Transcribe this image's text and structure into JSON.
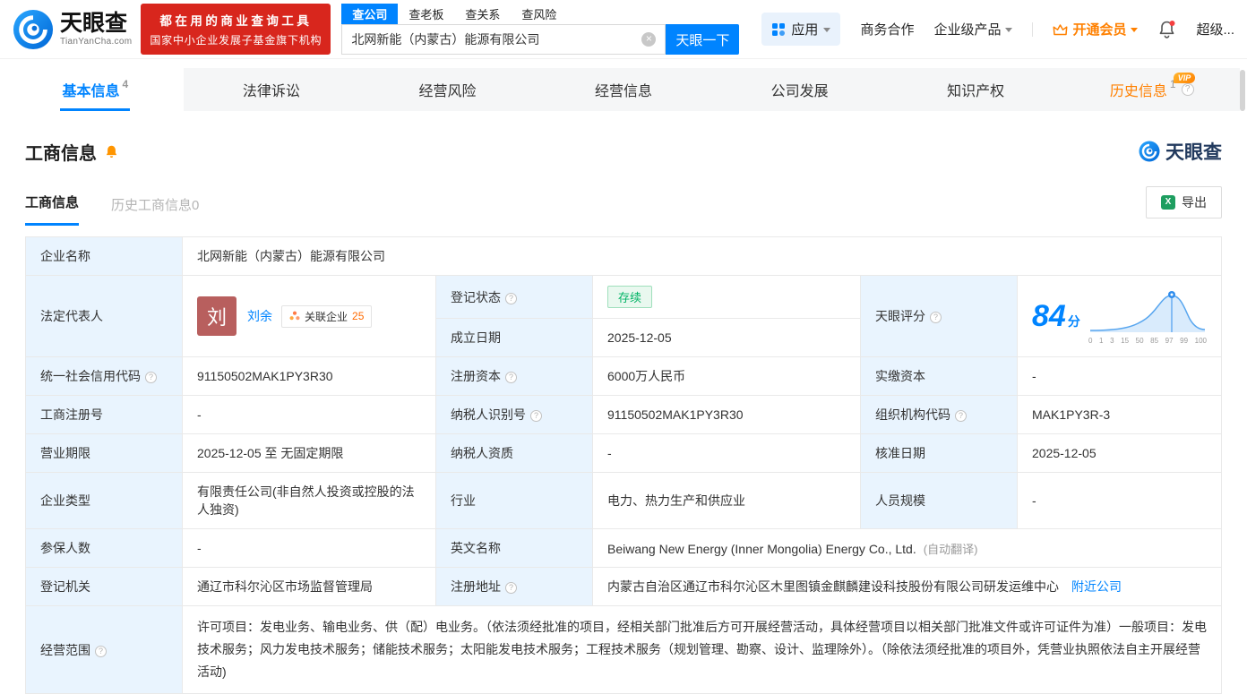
{
  "header": {
    "logo_cn": "天眼查",
    "logo_en": "TianYanCha.com",
    "promo_line1": "都在用的商业查询工具",
    "promo_line2": "国家中小企业发展子基金旗下机构",
    "search_tabs": [
      "查公司",
      "查老板",
      "查关系",
      "查风险"
    ],
    "search_value": "北网新能（内蒙古）能源有限公司",
    "search_button": "天眼一下",
    "apps_label": "应用",
    "nav_cooperation": "商务合作",
    "nav_enterprise": "企业级产品",
    "nav_vip": "开通会员",
    "nav_super": "超级..."
  },
  "tabs": {
    "basic": "基本信息",
    "basic_count": "4",
    "legal": "法律诉讼",
    "risk": "经营风险",
    "operation": "经营信息",
    "development": "公司发展",
    "ip": "知识产权",
    "history": "历史信息",
    "history_count": "1",
    "history_vip": "VIP"
  },
  "section": {
    "title": "工商信息",
    "brand": "天眼查",
    "subtab_active": "工商信息",
    "subtab_history": "历史工商信息0",
    "export_label": "导出"
  },
  "info": {
    "company_name_label": "企业名称",
    "company_name": "北网新能（内蒙古）能源有限公司",
    "legal_rep_label": "法定代表人",
    "legal_rep_avatar": "刘",
    "legal_rep_name": "刘余",
    "related_label": "关联企业",
    "related_count": "25",
    "reg_status_label": "登记状态",
    "reg_status": "存续",
    "establish_label": "成立日期",
    "establish_date": "2025-12-05",
    "score_label": "天眼评分",
    "score_value": "84",
    "score_unit": "分",
    "credit_code_label": "统一社会信用代码",
    "credit_code": "91150502MAK1PY3R30",
    "reg_capital_label": "注册资本",
    "reg_capital": "6000万人民币",
    "paid_capital_label": "实缴资本",
    "paid_capital": "-",
    "reg_no_label": "工商注册号",
    "reg_no": "-",
    "taxpayer_id_label": "纳税人识别号",
    "taxpayer_id": "91150502MAK1PY3R30",
    "org_code_label": "组织机构代码",
    "org_code": "MAK1PY3R-3",
    "term_label": "营业期限",
    "term": "2025-12-05 至 无固定期限",
    "taxpayer_qual_label": "纳税人资质",
    "taxpayer_qual": "-",
    "approval_label": "核准日期",
    "approval_date": "2025-12-05",
    "type_label": "企业类型",
    "type": "有限责任公司(非自然人投资或控股的法人独资)",
    "industry_label": "行业",
    "industry": "电力、热力生产和供应业",
    "staff_label": "人员规模",
    "staff": "-",
    "insured_label": "参保人数",
    "insured": "-",
    "en_name_label": "英文名称",
    "en_name": "Beiwang New Energy (Inner Mongolia) Energy Co., Ltd.",
    "en_name_note": "(自动翻译)",
    "authority_label": "登记机关",
    "authority": "通辽市科尔沁区市场监督管理局",
    "address_label": "注册地址",
    "address": "内蒙古自治区通辽市科尔沁区木里图镇金麒麟建设科技股份有限公司研发运维中心",
    "nearby": "附近公司",
    "scope_label": "经营范围",
    "scope": "许可项目：发电业务、输电业务、供（配）电业务。（依法须经批准的项目，经相关部门批准后方可开展经营活动，具体经营项目以相关部门批准文件或许可证件为准）一般项目：发电技术服务；风力发电技术服务；储能技术服务；太阳能发电技术服务；工程技术服务（规划管理、勘察、设计、监理除外）。（除依法须经批准的项目外，凭营业执照依法自主开展经营活动)"
  },
  "score_chart": {
    "type": "area",
    "score": 84,
    "ticks": [
      "0",
      "1",
      "3",
      "15",
      "50",
      "85",
      "97",
      "99",
      "100"
    ]
  },
  "icons": {
    "clear": "×",
    "help": "?",
    "excel": "X"
  },
  "colors": {
    "brand_blue": "#0084ff",
    "promo_red": "#d8261d",
    "vip_orange": "#ff8000",
    "status_green": "#00b365",
    "label_cell_bg": "#e9f4fe"
  }
}
